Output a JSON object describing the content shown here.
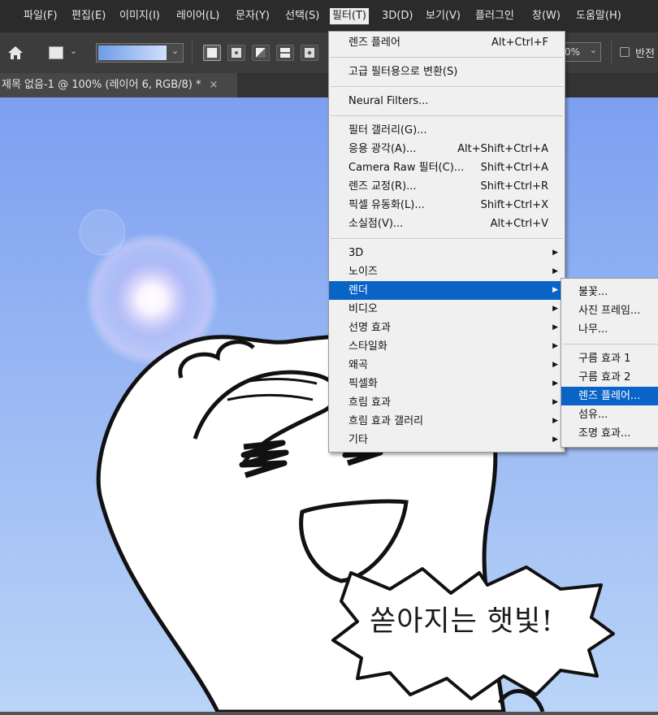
{
  "menubar": {
    "items": [
      "파일(F)",
      "편집(E)",
      "이미지(I)",
      "레이어(L)",
      "문자(Y)",
      "선택(S)",
      "필터(T)",
      "3D(D)",
      "보기(V)",
      "플러그인",
      "창(W)",
      "도움말(H)"
    ],
    "active": "필터(T)"
  },
  "options": {
    "percent_label": "0%",
    "reverse_label": "반전"
  },
  "document": {
    "tab_title": "제목 없음-1 @ 100% (레이어 6, RGB/8) *",
    "close_glyph": "×"
  },
  "filter_menu": {
    "groups": [
      [
        {
          "label": "렌즈 플레어",
          "shortcut": "Alt+Ctrl+F"
        }
      ],
      [
        {
          "label": "고급 필터용으로 변환(S)",
          "shortcut": ""
        }
      ],
      [
        {
          "label": "Neural Filters...",
          "shortcut": ""
        }
      ],
      [
        {
          "label": "필터 갤러리(G)...",
          "shortcut": ""
        },
        {
          "label": "응용 광각(A)...",
          "shortcut": "Alt+Shift+Ctrl+A"
        },
        {
          "label": "Camera Raw 필터(C)...",
          "shortcut": "Shift+Ctrl+A"
        },
        {
          "label": "렌즈 교정(R)...",
          "shortcut": "Shift+Ctrl+R"
        },
        {
          "label": "픽셀 유동화(L)...",
          "shortcut": "Shift+Ctrl+X"
        },
        {
          "label": "소실점(V)...",
          "shortcut": "Alt+Ctrl+V"
        }
      ],
      [
        {
          "label": "3D",
          "submenu": true
        },
        {
          "label": "노이즈",
          "submenu": true
        },
        {
          "label": "렌더",
          "submenu": true,
          "selected": true
        },
        {
          "label": "비디오",
          "submenu": true
        },
        {
          "label": "선명 효과",
          "submenu": true
        },
        {
          "label": "스타일화",
          "submenu": true
        },
        {
          "label": "왜곡",
          "submenu": true
        },
        {
          "label": "픽셀화",
          "submenu": true
        },
        {
          "label": "흐림 효과",
          "submenu": true
        },
        {
          "label": "흐림 효과 갤러리",
          "submenu": true
        },
        {
          "label": "기타",
          "submenu": true
        }
      ]
    ]
  },
  "render_submenu": {
    "groups": [
      [
        {
          "label": "불꽃..."
        },
        {
          "label": "사진 프레임..."
        },
        {
          "label": "나무..."
        }
      ],
      [
        {
          "label": "구름 효과 1"
        },
        {
          "label": "구름 효과 2"
        },
        {
          "label": "렌즈 플레어...",
          "selected": true
        },
        {
          "label": "섬유..."
        },
        {
          "label": "조명 효과..."
        }
      ]
    ]
  },
  "canvas": {
    "speech_bubble_text": "쏟아지는 햇빛!",
    "sky_top_color": "#7d9ff0",
    "sky_bottom_color": "#b9d4f7"
  },
  "colors": {
    "menu_highlight": "#0a64c8",
    "menubar_bg": "#2b2b2b"
  }
}
